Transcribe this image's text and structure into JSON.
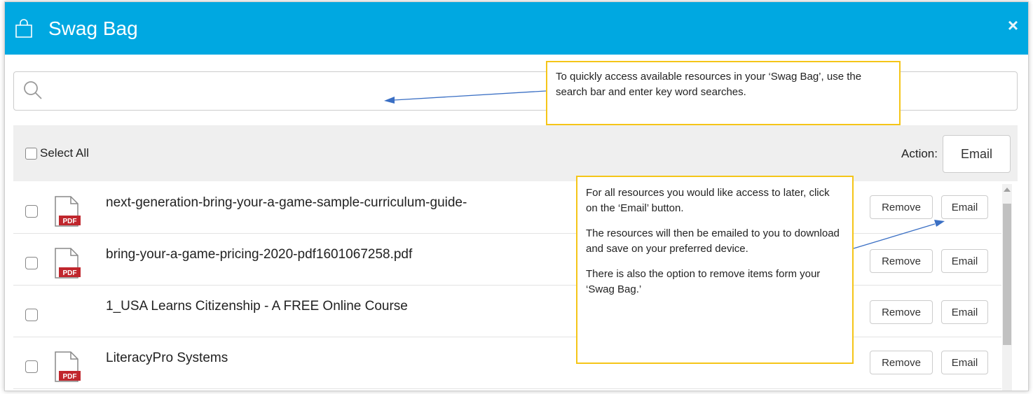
{
  "header": {
    "title": "Swag Bag",
    "close_glyph": "×",
    "bg_color": "#00a8e1",
    "icons": {
      "bag": "shopping-bag-icon",
      "close": "close-icon"
    }
  },
  "search": {
    "placeholder": "",
    "value": "",
    "icon": "search-icon"
  },
  "toolbar": {
    "select_all_label": "Select All",
    "action_label": "Action:",
    "email_label": "Email"
  },
  "items": [
    {
      "name": "next-generation-bring-your-a-game-sample-curriculum-guide-",
      "has_pdf_icon": true,
      "remove_label": "Remove",
      "email_label": "Email"
    },
    {
      "name": "bring-your-a-game-pricing-2020-pdf1601067258.pdf",
      "has_pdf_icon": true,
      "remove_label": "Remove",
      "email_label": "Email"
    },
    {
      "name": "1_USA Learns Citizenship - A FREE Online Course",
      "has_pdf_icon": false,
      "remove_label": "Remove",
      "email_label": "Email"
    },
    {
      "name": "LiteracyPro Systems",
      "has_pdf_icon": true,
      "remove_label": "Remove",
      "email_label": "Email"
    }
  ],
  "pdf_icon_text": "PDF",
  "callouts": {
    "search": {
      "text": "To quickly access available resources in your ‘Swag Bag’, use the search bar and enter key word searches."
    },
    "email": {
      "line1": "For all resources you would like access to later, click on the ‘Email’ button.",
      "line2": "The resources will then be emailed to you to download and save on your preferred device.",
      "line3": "There is also the option to remove items form your ‘Swag Bag.’"
    },
    "border_color": "#f5c518",
    "arrow_color": "#3a6fc4"
  }
}
